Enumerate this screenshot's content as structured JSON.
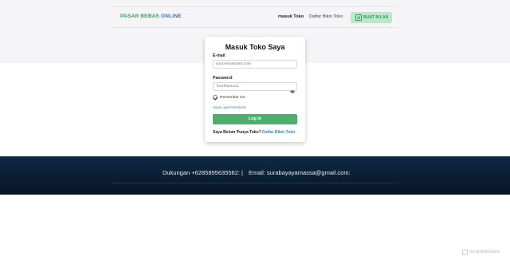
{
  "header": {
    "logo_part1": "PASAR BEBAS",
    "logo_part2": " ONLINE",
    "nav": {
      "masuk_label": "masuk Toko",
      "daftar_label": "Daftar Bikin Toko"
    },
    "cta_label": "BUAT IKLAN"
  },
  "login_form": {
    "title": "Masuk Toko Saya",
    "email_label": "E-mail",
    "email_placeholder": "your.email@dot.com",
    "password_label": "Password",
    "password_placeholder": "YourPass123",
    "remember_label": "Remember me",
    "remember_checked": true,
    "forgot_label": "Saya Lupa Password",
    "login_button": "Log In",
    "register_prompt": "Saya Belum Punya Toko?",
    "register_link": "Daftar Bikin Toko"
  },
  "footer": {
    "phone": "Dukungan +6285895635562:",
    "separator": "|",
    "email": "Email: surabayayamassa@gmail.com:"
  },
  "watermark": {
    "text": "ScanMalware"
  },
  "colors": {
    "accent_green": "#4bb06e",
    "logo_green": "#2f9e5a",
    "logo_blue": "#3b6fb6",
    "link_blue": "#3b82c4",
    "footer_bg": "#0e2a45",
    "cta_bg": "#bfe6cc"
  },
  "icons": {
    "cta_icon": "plus-square-icon",
    "password_toggle": "eye-icon",
    "remember_check": "check-circle-icon",
    "watermark_icon": "scan-icon"
  }
}
